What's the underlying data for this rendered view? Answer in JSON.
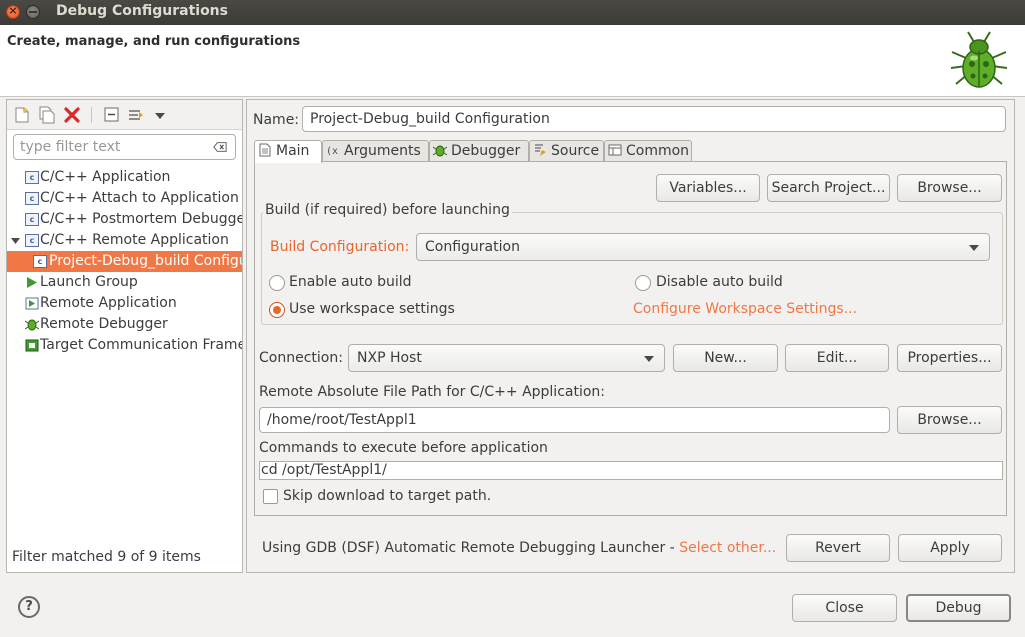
{
  "window": {
    "title": "Debug Configurations",
    "close_glyph": "×"
  },
  "header": {
    "text": "Create, manage, and run configurations",
    "icon": "debug-bug-icon"
  },
  "left": {
    "toolbar_icons": [
      "new-config-icon",
      "duplicate-icon",
      "delete-icon",
      "collapse-all-icon",
      "filter-icon",
      "view-menu-icon"
    ],
    "filter_placeholder": "type filter text",
    "tree": [
      {
        "label": "C/C++ Application",
        "icon": "c-config-icon",
        "indent": 0
      },
      {
        "label": "C/C++ Attach to Application",
        "icon": "c-config-icon",
        "indent": 0
      },
      {
        "label": "C/C++ Postmortem Debugger",
        "icon": "c-config-icon",
        "indent": 0
      },
      {
        "label": "C/C++ Remote Application",
        "icon": "c-config-icon",
        "indent": 0,
        "expanded": true
      },
      {
        "label": "Project-Debug_build Configuration",
        "icon": "c-config-icon",
        "indent": 1,
        "selected": true
      },
      {
        "label": "Launch Group",
        "icon": "launch-group-icon",
        "indent": 0
      },
      {
        "label": "Remote Application",
        "icon": "remote-app-icon",
        "indent": 0
      },
      {
        "label": "Remote Debugger",
        "icon": "remote-debugger-icon",
        "indent": 0
      },
      {
        "label": "Target Communication Framework",
        "icon": "tcf-icon",
        "indent": 0
      }
    ],
    "status": "Filter matched 9 of 9 items"
  },
  "right": {
    "name_label": "Name:",
    "name_value": "Project-Debug_build Configuration",
    "tabs": [
      {
        "label": "Main",
        "icon": "main-tab-icon",
        "active": true
      },
      {
        "label": "Arguments",
        "icon": "arguments-tab-icon"
      },
      {
        "label": "Debugger",
        "icon": "debugger-tab-icon"
      },
      {
        "label": "Source",
        "icon": "source-tab-icon"
      },
      {
        "label": "Common",
        "icon": "common-tab-icon"
      }
    ],
    "top_buttons": [
      "Variables...",
      "Search Project...",
      "Browse..."
    ],
    "build_group_title": "Build (if required) before launching",
    "build_config_label": "Build Configuration:",
    "build_config_value": "Configuration",
    "radio_enable": "Enable auto build",
    "radio_disable": "Disable auto build",
    "radio_workspace": "Use workspace settings",
    "configure_link": "Configure Workspace Settings...",
    "connection_label": "Connection:",
    "connection_value": "NXP Host",
    "connection_buttons": [
      "New...",
      "Edit...",
      "Properties..."
    ],
    "remote_path_label": "Remote Absolute File Path for C/C++ Application:",
    "remote_path_value": "/home/root/TestAppl1",
    "remote_browse": "Browse...",
    "commands_label": "Commands to execute before application",
    "commands_value": "cd /opt/TestAppl1/",
    "skip_download_label": "Skip download to target path.",
    "launcher_text": "Using GDB (DSF) Automatic Remote Debugging Launcher - ",
    "select_other_link": "Select other...",
    "revert_label": "Revert",
    "apply_label": "Apply"
  },
  "footer": {
    "help_glyph": "?",
    "close_label": "Close",
    "debug_label": "Debug"
  },
  "colors": {
    "accent": "#f07746",
    "title_bar": "#3c3b37",
    "selection": "#f07746"
  }
}
